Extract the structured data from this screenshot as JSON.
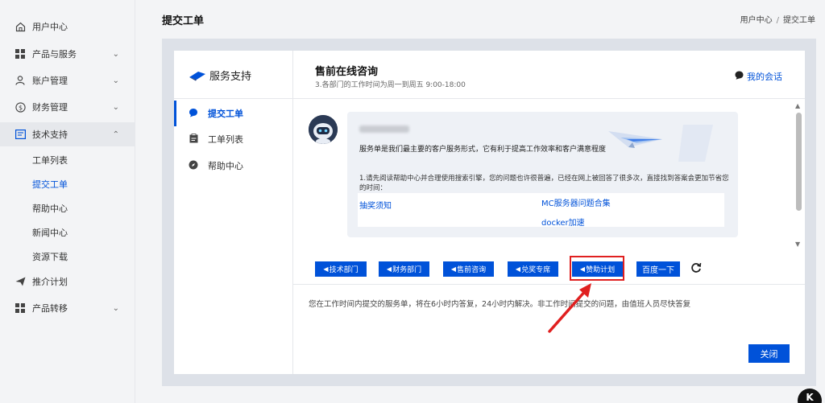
{
  "sidebar": {
    "items": [
      {
        "label": "用户中心",
        "icon": "home-icon",
        "chevron": ""
      },
      {
        "label": "产品与服务",
        "icon": "grid-icon",
        "chevron": "⌄"
      },
      {
        "label": "账户管理",
        "icon": "user-icon",
        "chevron": "⌄"
      },
      {
        "label": "财务管理",
        "icon": "dollar-icon",
        "chevron": "⌄"
      },
      {
        "label": "技术支持",
        "icon": "ticket-icon",
        "chevron": "⌃"
      }
    ],
    "sub_items": [
      "工单列表",
      "提交工单",
      "帮助中心",
      "新闻中心",
      "资源下载"
    ],
    "bottom_items": [
      {
        "label": "推介计划",
        "icon": "send-icon"
      },
      {
        "label": "产品转移",
        "icon": "grid-icon",
        "chevron": "⌄"
      }
    ]
  },
  "header": {
    "title": "提交工单",
    "breadcrumb": [
      "用户中心",
      "提交工单"
    ],
    "breadcrumb_sep": "/"
  },
  "support": {
    "brand": "服务支持",
    "menu": [
      {
        "label": "提交工单",
        "icon": "chat-icon"
      },
      {
        "label": "工单列表",
        "icon": "clipboard-icon"
      },
      {
        "label": "帮助中心",
        "icon": "compass-icon"
      }
    ]
  },
  "main": {
    "title": "售前在线咨询",
    "subtitle": "3.各部门的工作时间为周一到周五 9:00-18:00",
    "my_session": "我的会话",
    "bubble": {
      "line1": "服务单是我们最主要的客户服务形式，它有利于提高工作效率和客户满意程度",
      "line2": "1.请先阅读帮助中心并合理使用搜索引擎，您的问题也许很普遍，已经在网上被回答了很多次，直接找到答案会更加节省您的时间：",
      "links": [
        "抽奖须知",
        "MC服务器问题合集",
        "docker加速"
      ]
    },
    "departments": [
      "技术部门",
      "财务部门",
      "售前咨询",
      "兑奖专席",
      "赞助计划",
      "百度一下"
    ],
    "notice": "您在工作时间内提交的服务单，将在6小时内答复，24小时内解决。非工作时间提交的问题，由值班人员尽快答复",
    "close": "关闭"
  },
  "badge": "K",
  "colors": {
    "accent": "#0052d9",
    "highlight": "#e02020",
    "arrow": "#e02020"
  }
}
